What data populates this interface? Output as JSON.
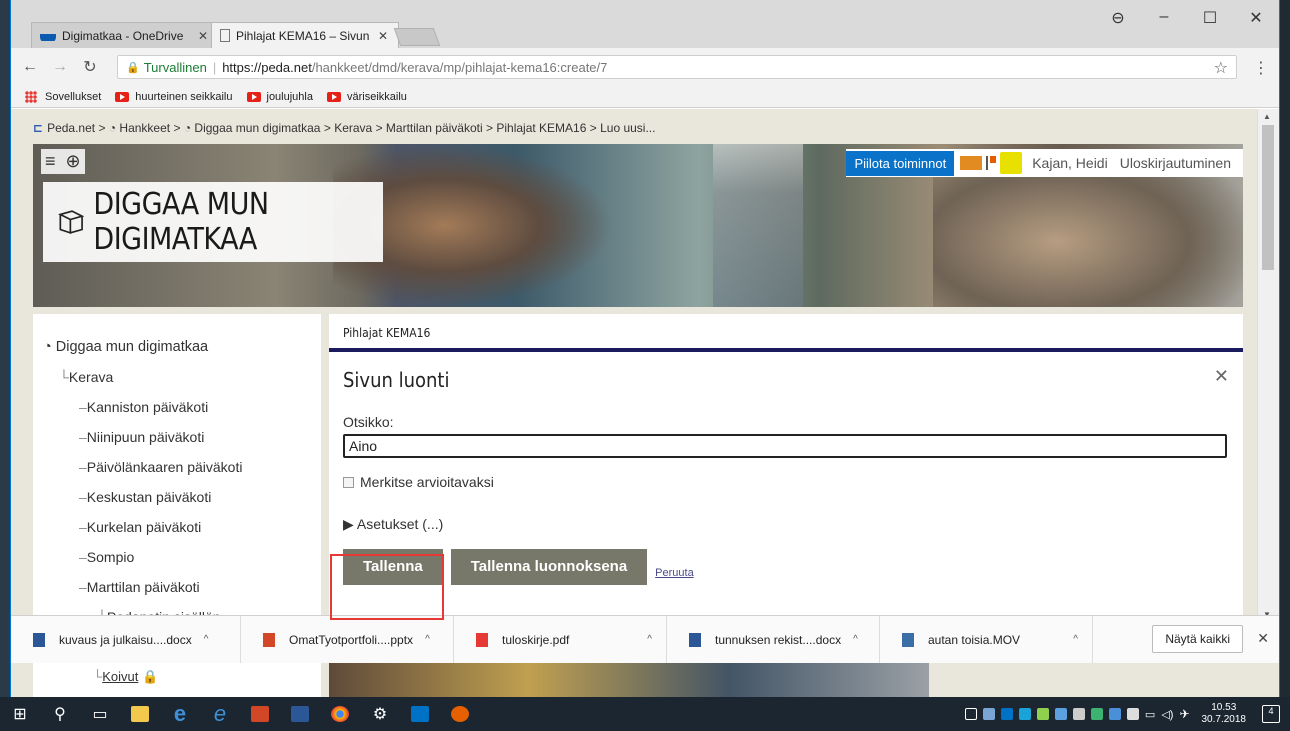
{
  "browser": {
    "tabs": [
      {
        "label": "Digimatkaa - OneDrive",
        "icon": "onedrive-icon"
      },
      {
        "label": "Pihlajat KEMA16 – Sivun",
        "icon": "page-icon"
      }
    ],
    "security_label": "Turvallinen",
    "url_host": "https://peda.net",
    "url_path": "/hankkeet/dmd/kerava/mp/pihlajat-kema16:create/7",
    "bookmarks": [
      "Sovellukset",
      "huurteinen seikkailu",
      "joulujuhla",
      "väriseikkailu"
    ]
  },
  "breadcrumb": {
    "items": [
      "Peda.net",
      "Hankkeet",
      "Diggaa mun digimatkaa",
      "Kerava",
      "Marttilan päiväkoti",
      "Pihlajat KEMA16",
      "Luo uusi..."
    ],
    "separator": ">"
  },
  "header": {
    "site_title": "DIGGAA MUN DIGIMATKAA",
    "hide_button": "Piilota toiminnot",
    "user_name": "Kajan, Heidi",
    "logout": "Uloskirjautuminen"
  },
  "sidebar": {
    "root": "Diggaa mun digimatkaa",
    "level1": "Kerava",
    "level2": [
      "Kanniston päiväkoti",
      "Niinipuun päiväkoti",
      "Päivölänkaaren päiväkoti",
      "Keskustan päiväkoti",
      "Kurkelan päiväkoti",
      "Sompio",
      "Marttilan päiväkoti"
    ],
    "level3": "Pedanetin sisällön",
    "lower_item": "Koivut"
  },
  "main": {
    "tab_label": "Pihlajat KEMA16",
    "form_title": "Sivun luonti",
    "title_label": "Otsikko:",
    "title_value": "Aino",
    "checkbox_label": "Merkitse arvioitavaksi",
    "settings_label": "Asetukset (...)",
    "save": "Tallenna",
    "save_draft": "Tallenna luonnoksena",
    "cancel": "Peruuta"
  },
  "downloads": {
    "items": [
      {
        "name": "kuvaus ja julkaisu....docx",
        "type": "word"
      },
      {
        "name": "OmatTyotportfoli....pptx",
        "type": "powerpoint"
      },
      {
        "name": "tuloskirje.pdf",
        "type": "pdf"
      },
      {
        "name": "tunnuksen rekist....docx",
        "type": "word"
      },
      {
        "name": "autan toisia.MOV",
        "type": "video"
      }
    ],
    "show_all": "Näytä kaikki"
  },
  "taskbar": {
    "time": "10.53",
    "date": "30.7.2018",
    "notifications": "4"
  },
  "colors": {
    "accent": "#0a72c8",
    "button": "#78786a",
    "tab_underline": "#1a1a5e",
    "highlight": "#e53935"
  }
}
